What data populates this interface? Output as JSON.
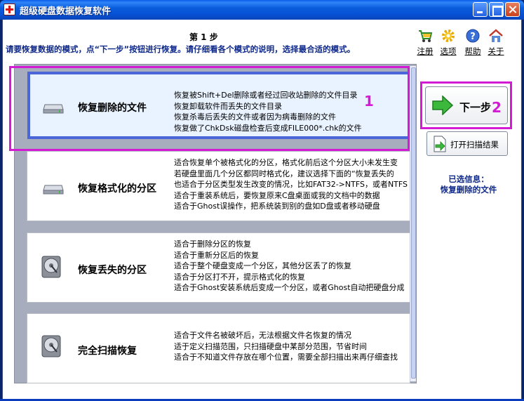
{
  "window": {
    "title": "超级硬盘数据恢复软件"
  },
  "header": {
    "step": "第 1 步",
    "instruction": "请要恢复数据的模式，点“下一步”按钮进行恢复。请仔细看各个模式的说明，选择最合适的模式。"
  },
  "toolbar": [
    {
      "label": "注册",
      "icon": "cart-icon"
    },
    {
      "label": "选项",
      "icon": "gear-icon"
    },
    {
      "label": "帮助",
      "icon": "help-icon"
    },
    {
      "label": "关于",
      "icon": "home-icon"
    }
  ],
  "modes": [
    {
      "name": "恢复删除的文件",
      "selected": true,
      "lines": [
        "恢复被Shift+Del删除或者经过回收站删除的文件目录",
        "恢复卸载软件而丢失的文件目录",
        "恢复杀毒后丢失的文件或者因为病毒删除的文件",
        "恢复做了ChkDsk磁盘检查后变成FILE000*.chk的文件"
      ]
    },
    {
      "name": "恢复格式化的分区",
      "selected": false,
      "lines": [
        "适合恢复单个被格式化的分区，格式化前后这个分区大小未发生变",
        "若硬盘里面几个分区都同时格式化，建议选择下面的“恢复丢失的",
        "也适合于分区类型发生改变的情况，比如FAT32->NTFS，或者NTFS",
        "适合于重装系统后，要恢复原来C盘桌面或我的文档中的数据",
        "适合于Ghost误操作，把系统装到别的盘如D盘或者移动硬盘"
      ]
    },
    {
      "name": "恢复丢失的分区",
      "selected": false,
      "lines": [
        "适合于删除分区的恢复",
        "适合于重新分区后的恢复",
        "适合于整个硬盘变成一个分区，其他分区丢了的恢复",
        "适合于分区打不开，提示格式化的恢复",
        "适合于Ghost安装系统后变成一个分区，或者Ghost自动把硬盘分成"
      ]
    },
    {
      "name": "完全扫描恢复",
      "selected": false,
      "lines": [
        "适合于文件名被破坏后，无法根据文件名恢复的情况",
        "适于定义扫描范围，只扫描硬盘中某部分范围，节省时间",
        "适合于不知道文件存放在哪个位置，需要全部扫描出来再仔细查找"
      ]
    }
  ],
  "actions": {
    "next": "下一步",
    "open_scan": "打开扫描结果"
  },
  "selection": {
    "heading": "已选信息：",
    "value": "恢复删除的文件"
  },
  "annotations": {
    "marker_1": "1",
    "marker_2": "2"
  },
  "colors": {
    "accent": "#4a66d8",
    "highlight": "#d21bd2",
    "info_text": "#102a8a"
  }
}
